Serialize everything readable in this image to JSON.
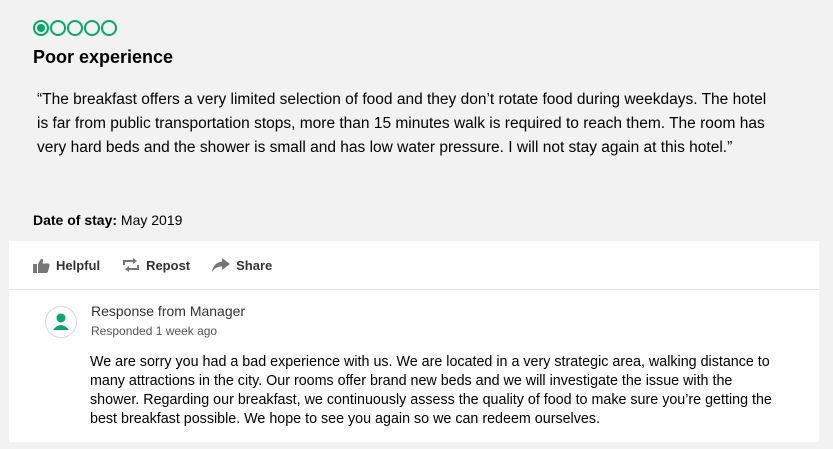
{
  "review": {
    "rating": 1,
    "rating_max": 5,
    "title": "Poor experience",
    "text": "“The breakfast offers a very limited selection of food and they don’t rotate food during weekdays. The hotel is far from public transportation stops, more than 15 minutes walk is required to reach them. The room has very hard beds and the shower is small and has low water pressure. I will not stay again at this hotel.”",
    "date_label": "Date of stay:",
    "date_value": "May 2019"
  },
  "actions": {
    "helpful": "Helpful",
    "repost": "Repost",
    "share": "Share"
  },
  "response": {
    "title": "Response from Manager",
    "time": "Responded 1 week ago",
    "text": "We are sorry you had a bad experience with us. We are located in a very strategic area, walking distance to many attractions in the city. Our rooms offer brand new beds and we will investigate the issue with the shower. Regarding our breakfast, we continuously assess the quality of food to make sure you’re getting the best breakfast possible. We hope to see you again so we can redeem ourselves."
  },
  "colors": {
    "bubble": "#00aa6c",
    "avatar": "#00aa6c"
  },
  "icons": {
    "helpful": "thumbs-up-icon",
    "repost": "repost-icon",
    "share": "share-icon",
    "avatar": "user-icon"
  }
}
